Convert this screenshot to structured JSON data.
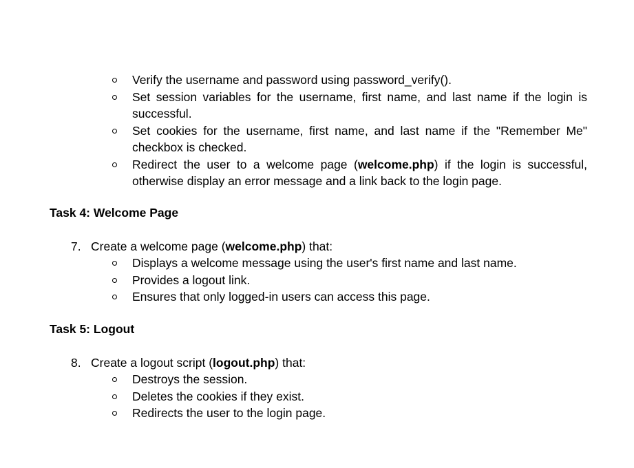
{
  "task3_bullets": [
    {
      "text": "Verify the username and password using password_verify()."
    },
    {
      "text": "Set session variables for the username, first name, and last name if the login is successful."
    },
    {
      "text": "Set cookies for the username, first name, and last name if the \"Remember Me\" checkbox is checked."
    },
    {
      "pre": "Redirect the user to a welcome page (",
      "bold": "welcome.php",
      "post": ") if the login is successful, otherwise display an error message and a link back to the login page."
    }
  ],
  "task4": {
    "heading": "Task 4: Welcome Page",
    "number": "7.",
    "item_pre": "Create a welcome page (",
    "item_bold": "welcome.php",
    "item_post": ") that:",
    "bullets": [
      "Displays a welcome message using the user's first name and last name.",
      "Provides a logout link.",
      "Ensures that only logged-in users can access this page."
    ]
  },
  "task5": {
    "heading": "Task 5: Logout",
    "number": "8.",
    "item_pre": "Create a logout script (",
    "item_bold": "logout.php",
    "item_post": ") that:",
    "bullets": [
      "Destroys the session.",
      "Deletes the cookies if they exist.",
      "Redirects the user to the login page."
    ]
  }
}
